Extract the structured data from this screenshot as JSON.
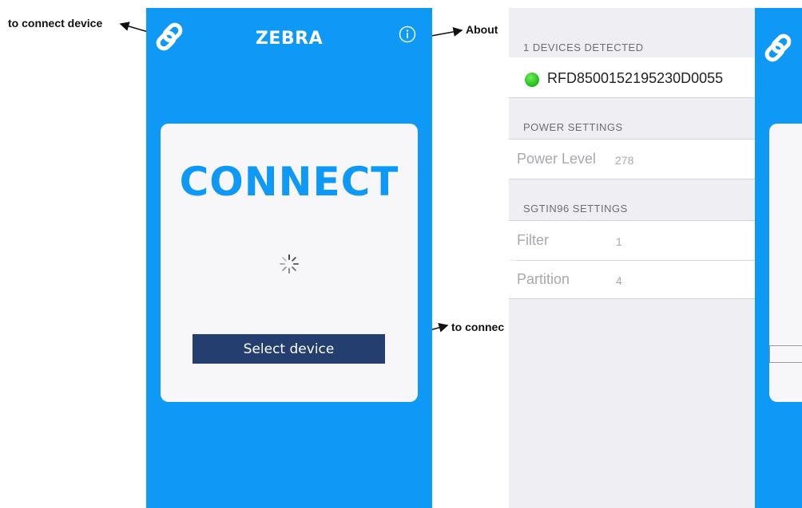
{
  "annotations": {
    "connect_device_label": "to connect device",
    "about_label": "About",
    "select_label": "to connec"
  },
  "left_phone": {
    "title": "ZEBRA",
    "link_icon": "link-icon",
    "info_icon": "info-icon",
    "connect_heading": "CONNECT",
    "spinner_icon": "loading-spinner-icon",
    "select_button_label": "Select device",
    "brand_color": "#0f99f7",
    "button_color": "#233e6f"
  },
  "settings_screen": {
    "devices_header": "1 DEVICES DETECTED",
    "device": {
      "name": "RFD8500152195230D0055",
      "status_color": "#2ec12a"
    },
    "power_header": "POWER SETTINGS",
    "power_level": {
      "label": "Power Level",
      "value": "278"
    },
    "sgtin_header": "SGTIN96 SETTINGS",
    "filter": {
      "label": "Filter",
      "value": "1"
    },
    "partition": {
      "label": "Partition",
      "value": "4"
    }
  }
}
